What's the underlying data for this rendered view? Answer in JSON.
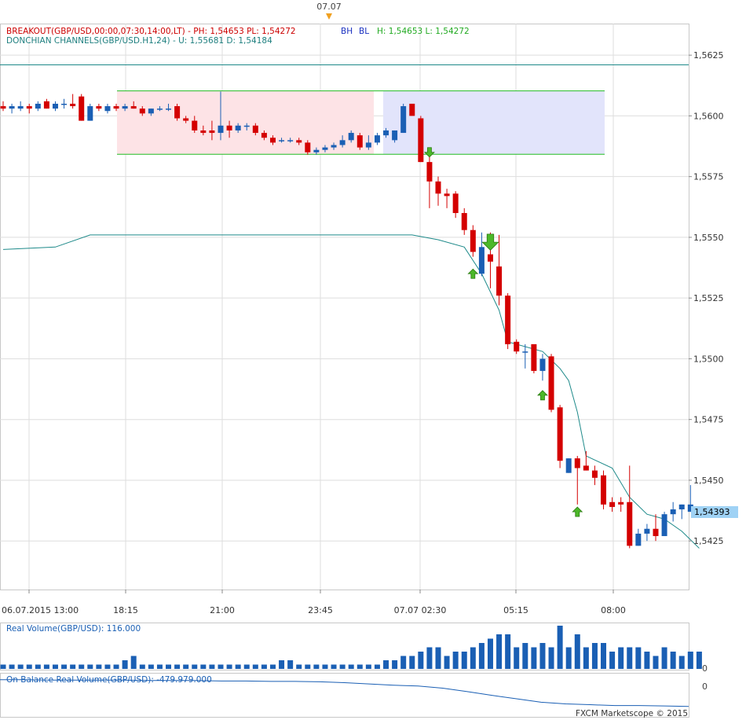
{
  "top_date_label": "07.07",
  "header": {
    "breakout_label": "BREAKOUT(GBP/USD,00:00,07:30,14:00,LT) -  PH: 1,54653  PL: 1,54272",
    "bh_label": "BH",
    "bl_label": "BL",
    "hl_label": "H: 1,54653  L: 1,54272",
    "donchian_label": "DONCHIAN CHANNELS(GBP/USD.H1,24) -  U: 1,55681  D: 1,54184"
  },
  "current_price_label": "1,54393",
  "volume_panel": {
    "label": "Real Volume(GBP/USD): 116.000",
    "zero_label": "0"
  },
  "obv_panel": {
    "label": "On Balance Real Volume(GBP/USD): -479.979.000",
    "zero_label": "0"
  },
  "copyright": "FXCM Marketscope © 2015",
  "colors": {
    "up": "#1a5fb4",
    "down": "#d40000",
    "donchian": "#1e8a8a",
    "band": "#22bb22",
    "range_pink": "#fde3e6",
    "range_blue": "#e2e4fb",
    "price_tag": "#9fd2f5"
  },
  "chart_data": {
    "type": "candlestick",
    "y_ticks": [
      "1,5625",
      "1,5600",
      "1,5575",
      "1,5550",
      "1,5525",
      "1,5500",
      "1,5475",
      "1,5450",
      "1,5425"
    ],
    "x_ticks": [
      "06.07.2015 13:00",
      "18:15",
      "21:00",
      "23:45",
      "07.07 02:30",
      "05:15",
      "08:00"
    ],
    "ylim": [
      1.5405,
      1.5638
    ],
    "breakout_high": 1.56103,
    "breakout_low": 1.55842,
    "donchian_upper": 1.5621,
    "candles": [
      [
        1.5604,
        1.5606,
        1.5602,
        1.5603
      ],
      [
        1.5603,
        1.5605,
        1.5601,
        1.5604
      ],
      [
        1.5603,
        1.5606,
        1.5602,
        1.5604
      ],
      [
        1.5604,
        1.5605,
        1.5601,
        1.5603
      ],
      [
        1.5603,
        1.5606,
        1.5602,
        1.5605
      ],
      [
        1.5606,
        1.5607,
        1.5603,
        1.5603
      ],
      [
        1.5603,
        1.5606,
        1.5602,
        1.5605
      ],
      [
        1.5605,
        1.5607,
        1.5603,
        1.5605
      ],
      [
        1.5605,
        1.5609,
        1.5603,
        1.5604
      ],
      [
        1.5608,
        1.5609,
        1.5598,
        1.5598
      ],
      [
        1.5598,
        1.5605,
        1.5598,
        1.5604
      ],
      [
        1.5604,
        1.5605,
        1.5602,
        1.5603
      ],
      [
        1.5602,
        1.5605,
        1.5601,
        1.5604
      ],
      [
        1.5604,
        1.5605,
        1.5602,
        1.5603
      ],
      [
        1.5603,
        1.5605,
        1.5602,
        1.5604
      ],
      [
        1.5604,
        1.5606,
        1.5603,
        1.5603
      ],
      [
        1.5603,
        1.5604,
        1.56,
        1.5601
      ],
      [
        1.5601,
        1.5603,
        1.56,
        1.5603
      ],
      [
        1.5603,
        1.5604,
        1.5602,
        1.5603
      ],
      [
        1.5603,
        1.5605,
        1.5602,
        1.5603
      ],
      [
        1.5604,
        1.5605,
        1.5598,
        1.5599
      ],
      [
        1.5599,
        1.56,
        1.5597,
        1.5598
      ],
      [
        1.5598,
        1.56,
        1.5593,
        1.5594
      ],
      [
        1.5594,
        1.5596,
        1.5592,
        1.5593
      ],
      [
        1.5594,
        1.5598,
        1.559,
        1.5593
      ],
      [
        1.5593,
        1.561,
        1.559,
        1.5596
      ],
      [
        1.5596,
        1.5598,
        1.5591,
        1.5594
      ],
      [
        1.5594,
        1.5597,
        1.5593,
        1.5596
      ],
      [
        1.5596,
        1.5597,
        1.5594,
        1.5596
      ],
      [
        1.5596,
        1.5597,
        1.5592,
        1.5593
      ],
      [
        1.5593,
        1.5594,
        1.559,
        1.5591
      ],
      [
        1.5591,
        1.5592,
        1.5588,
        1.5589
      ],
      [
        1.559,
        1.5591,
        1.5589,
        1.559
      ],
      [
        1.559,
        1.5591,
        1.5589,
        1.559
      ],
      [
        1.559,
        1.5591,
        1.5588,
        1.5589
      ],
      [
        1.5589,
        1.559,
        1.5584,
        1.5585
      ],
      [
        1.5585,
        1.5587,
        1.5584,
        1.5586
      ],
      [
        1.5586,
        1.5588,
        1.5585,
        1.5587
      ],
      [
        1.5587,
        1.5589,
        1.5586,
        1.5588
      ],
      [
        1.5588,
        1.5592,
        1.5587,
        1.559
      ],
      [
        1.559,
        1.5594,
        1.5589,
        1.5593
      ],
      [
        1.5592,
        1.5593,
        1.5586,
        1.5587
      ],
      [
        1.5587,
        1.5592,
        1.5586,
        1.5589
      ],
      [
        1.5589,
        1.5593,
        1.5588,
        1.5592
      ],
      [
        1.5592,
        1.5595,
        1.5591,
        1.5594
      ],
      [
        1.559,
        1.5594,
        1.5589,
        1.5594
      ],
      [
        1.5593,
        1.5605,
        1.5593,
        1.5604
      ],
      [
        1.5605,
        1.5605,
        1.56,
        1.56
      ],
      [
        1.5599,
        1.56,
        1.5581,
        1.5581
      ],
      [
        1.5581,
        1.5583,
        1.5562,
        1.5573
      ],
      [
        1.5573,
        1.5575,
        1.5563,
        1.5568
      ],
      [
        1.5568,
        1.557,
        1.5562,
        1.5567
      ],
      [
        1.5568,
        1.5569,
        1.5558,
        1.556
      ],
      [
        1.556,
        1.5562,
        1.5551,
        1.5553
      ],
      [
        1.5553,
        1.5555,
        1.5542,
        1.5544
      ],
      [
        1.5535,
        1.5552,
        1.5534,
        1.5546
      ],
      [
        1.5543,
        1.5552,
        1.5529,
        1.554
      ],
      [
        1.5538,
        1.5551,
        1.5522,
        1.5526
      ],
      [
        1.5526,
        1.5527,
        1.5504,
        1.5506
      ],
      [
        1.5507,
        1.5508,
        1.5502,
        1.5503
      ],
      [
        1.5503,
        1.5506,
        1.5496,
        1.5503
      ],
      [
        1.5506,
        1.5506,
        1.5494,
        1.5495
      ],
      [
        1.5495,
        1.5502,
        1.5491,
        1.55
      ],
      [
        1.5501,
        1.5502,
        1.5478,
        1.5479
      ],
      [
        1.548,
        1.5481,
        1.5455,
        1.5458
      ],
      [
        1.5453,
        1.5459,
        1.5453,
        1.5459
      ],
      [
        1.5459,
        1.546,
        1.544,
        1.5455
      ],
      [
        1.5456,
        1.5462,
        1.5454,
        1.5454
      ],
      [
        1.5454,
        1.5456,
        1.5448,
        1.5451
      ],
      [
        1.5452,
        1.5454,
        1.5438,
        1.544
      ],
      [
        1.5441,
        1.5443,
        1.5437,
        1.5439
      ],
      [
        1.5441,
        1.5443,
        1.5437,
        1.544
      ],
      [
        1.5441,
        1.5456,
        1.5422,
        1.5423
      ],
      [
        1.5423,
        1.543,
        1.5423,
        1.5428
      ],
      [
        1.5428,
        1.5432,
        1.5425,
        1.543
      ],
      [
        1.543,
        1.5436,
        1.5425,
        1.5427
      ],
      [
        1.5427,
        1.5437,
        1.5427,
        1.5436
      ],
      [
        1.5436,
        1.5441,
        1.5433,
        1.5438
      ],
      [
        1.5438,
        1.544,
        1.5434,
        1.544
      ],
      [
        1.5437,
        1.5448,
        1.5437,
        1.544
      ]
    ],
    "donchian_lower": [
      [
        0,
        1.5545
      ],
      [
        6,
        1.5546
      ],
      [
        10,
        1.5551
      ],
      [
        17,
        1.5551
      ],
      [
        45,
        1.5551
      ],
      [
        47,
        1.5551
      ],
      [
        50,
        1.5549
      ],
      [
        53,
        1.5546
      ],
      [
        55,
        1.5535
      ],
      [
        57,
        1.552
      ],
      [
        58,
        1.5507
      ],
      [
        62,
        1.5503
      ],
      [
        64,
        1.5496
      ],
      [
        65,
        1.5491
      ],
      [
        66,
        1.5478
      ],
      [
        67,
        1.546
      ],
      [
        70,
        1.5455
      ],
      [
        72,
        1.5443
      ],
      [
        74,
        1.5436
      ],
      [
        76,
        1.5434
      ],
      [
        78,
        1.5429
      ],
      [
        80,
        1.5422
      ]
    ],
    "arrows": [
      {
        "index": 49,
        "price": 1.5585,
        "dir": "down",
        "size": "small"
      },
      {
        "index": 54,
        "price": 1.5535,
        "dir": "up",
        "size": "small"
      },
      {
        "index": 56,
        "price": 1.5548,
        "dir": "down",
        "size": "large"
      },
      {
        "index": 62,
        "price": 1.5485,
        "dir": "up",
        "size": "small"
      },
      {
        "index": 66,
        "price": 1.5437,
        "dir": "up",
        "size": "small"
      }
    ],
    "volume": [
      1,
      1,
      1,
      1,
      1,
      1,
      1,
      1,
      1,
      1,
      1,
      1,
      1,
      1,
      2,
      3,
      1,
      1,
      1,
      1,
      1,
      1,
      1,
      1,
      1,
      1,
      1,
      1,
      1,
      1,
      1,
      1,
      2,
      2,
      1,
      1,
      1,
      1,
      1,
      1,
      1,
      1,
      1,
      1,
      2,
      2,
      3,
      3,
      4,
      5,
      5,
      3,
      4,
      4,
      5,
      6,
      7,
      8,
      8,
      5,
      6,
      5,
      6,
      5,
      10,
      5,
      8,
      5,
      6,
      6,
      4,
      5,
      5,
      5,
      4,
      3,
      5,
      4,
      3,
      4,
      4
    ],
    "obv": [
      -0.05,
      -0.05,
      -0.06,
      -0.06,
      -0.06,
      -0.06,
      -0.07,
      -0.07,
      -0.07,
      -0.08,
      -0.08,
      -0.09,
      -0.09,
      -0.1,
      -0.12,
      -0.15,
      -0.18,
      -0.2,
      -0.25,
      -0.33,
      -0.42,
      -0.5,
      -0.58,
      -0.62,
      -0.64,
      -0.66,
      -0.66,
      -0.67,
      -0.68
    ]
  }
}
